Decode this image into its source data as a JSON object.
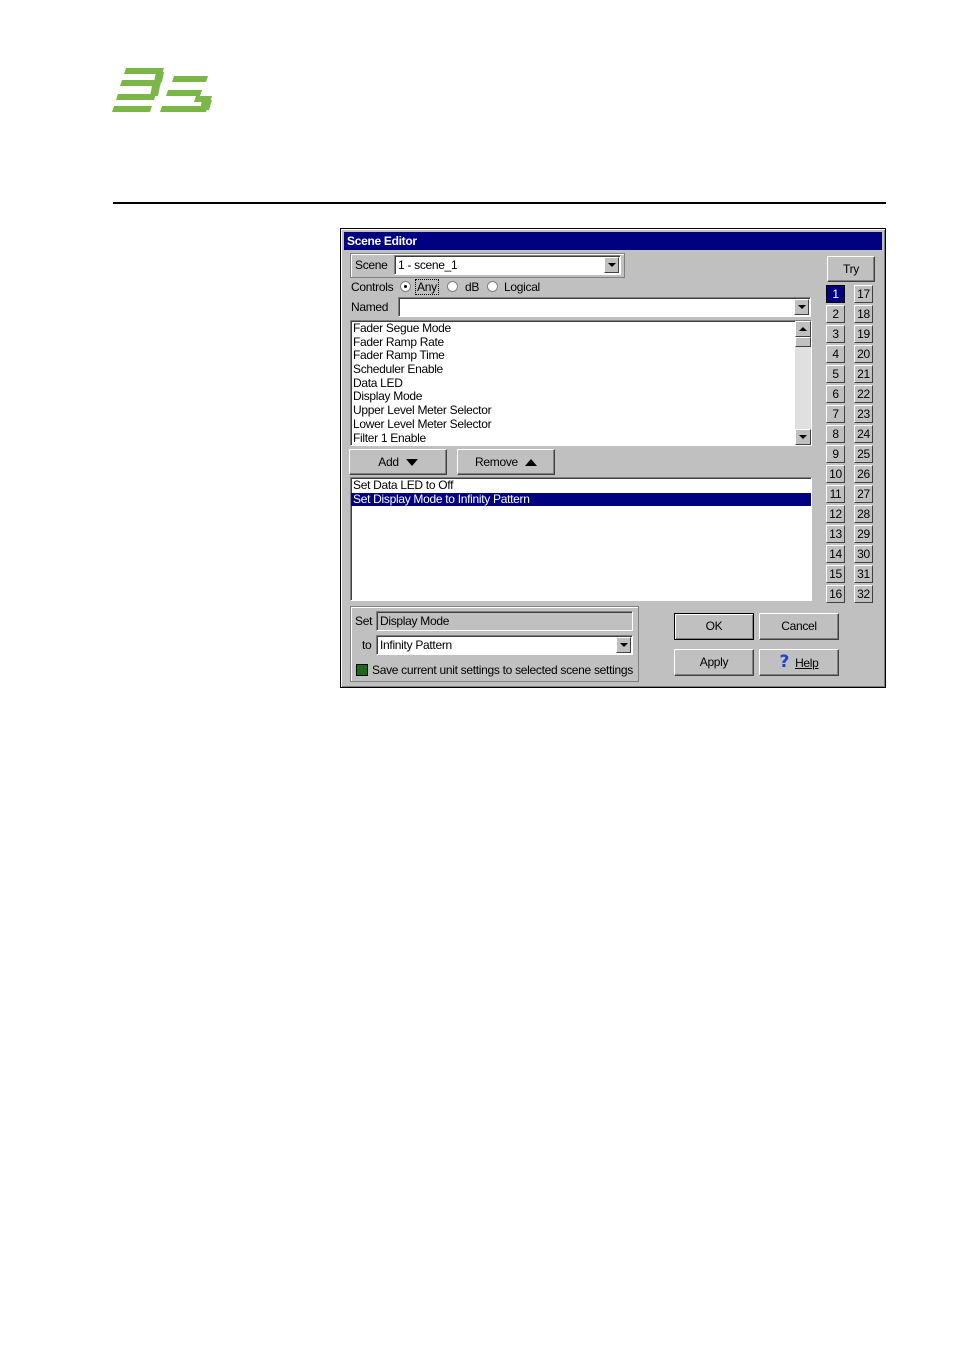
{
  "brand": {
    "name": "BSS",
    "color": "#7ab648"
  },
  "dialog": {
    "title": "Scene Editor",
    "scene_label": "Scene",
    "scene_value": "1 - scene_1",
    "controls_label": "Controls",
    "radio_options": [
      {
        "label": "Any",
        "checked": true
      },
      {
        "label": "dB",
        "checked": false
      },
      {
        "label": "Logical",
        "checked": false
      }
    ],
    "named_label": "Named",
    "named_value": "",
    "controls_list": [
      "Fader Segue Mode",
      "Fader Ramp Rate",
      "Fader Ramp Time",
      "Scheduler Enable",
      "Data LED",
      "Display Mode",
      "Upper Level Meter Selector",
      "Lower Level Meter Selector",
      "Filter 1 Enable"
    ],
    "add_label": "Add",
    "remove_label": "Remove",
    "scene_settings": [
      {
        "text": "Set Data LED to Off",
        "selected": false
      },
      {
        "text": "Set Display Mode to Infinity Pattern",
        "selected": true
      }
    ],
    "set_label": "Set",
    "set_value": "Display Mode",
    "to_label": "to",
    "to_value": "Infinity Pattern",
    "save_label": "Save current unit settings to selected scene settings",
    "try_label": "Try",
    "scene_numbers_left": [
      "1",
      "2",
      "3",
      "4",
      "5",
      "6",
      "7",
      "8",
      "9",
      "10",
      "11",
      "12",
      "13",
      "14",
      "15",
      "16"
    ],
    "scene_numbers_right": [
      "17",
      "18",
      "19",
      "20",
      "21",
      "22",
      "23",
      "24",
      "25",
      "26",
      "27",
      "28",
      "29",
      "30",
      "31",
      "32"
    ],
    "active_scene": "1",
    "ok_label": "OK",
    "cancel_label": "Cancel",
    "apply_label": "Apply",
    "help_icon_glyph": "?",
    "help_label": "Help"
  }
}
